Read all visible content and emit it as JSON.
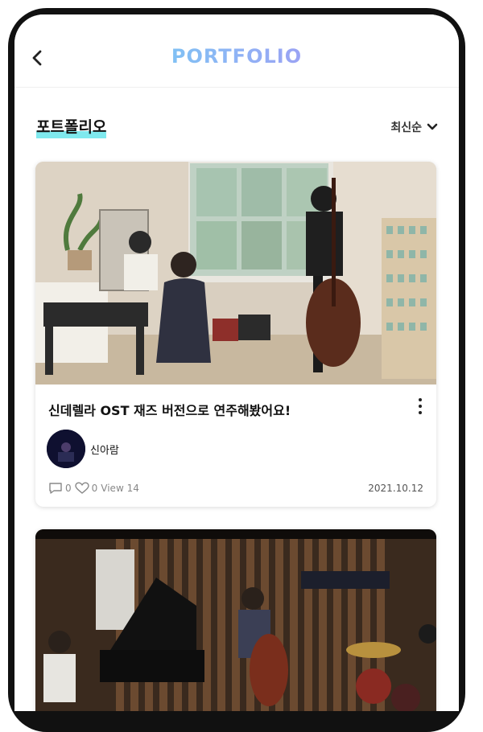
{
  "header": {
    "logo_text": "PORTFOLIO",
    "back_icon": "chevron-left-icon"
  },
  "section": {
    "title": "포트폴리오",
    "sort_label": "최신순",
    "sort_icon": "chevron-down-icon",
    "accent_color": "#7fe9ee"
  },
  "posts": [
    {
      "title": "신데렐라 OST 재즈 버전으로 연주해봤어요!",
      "author": "신아람",
      "comments": "0",
      "likes": "0",
      "views": "View 14",
      "date": "2021.10.12"
    }
  ]
}
